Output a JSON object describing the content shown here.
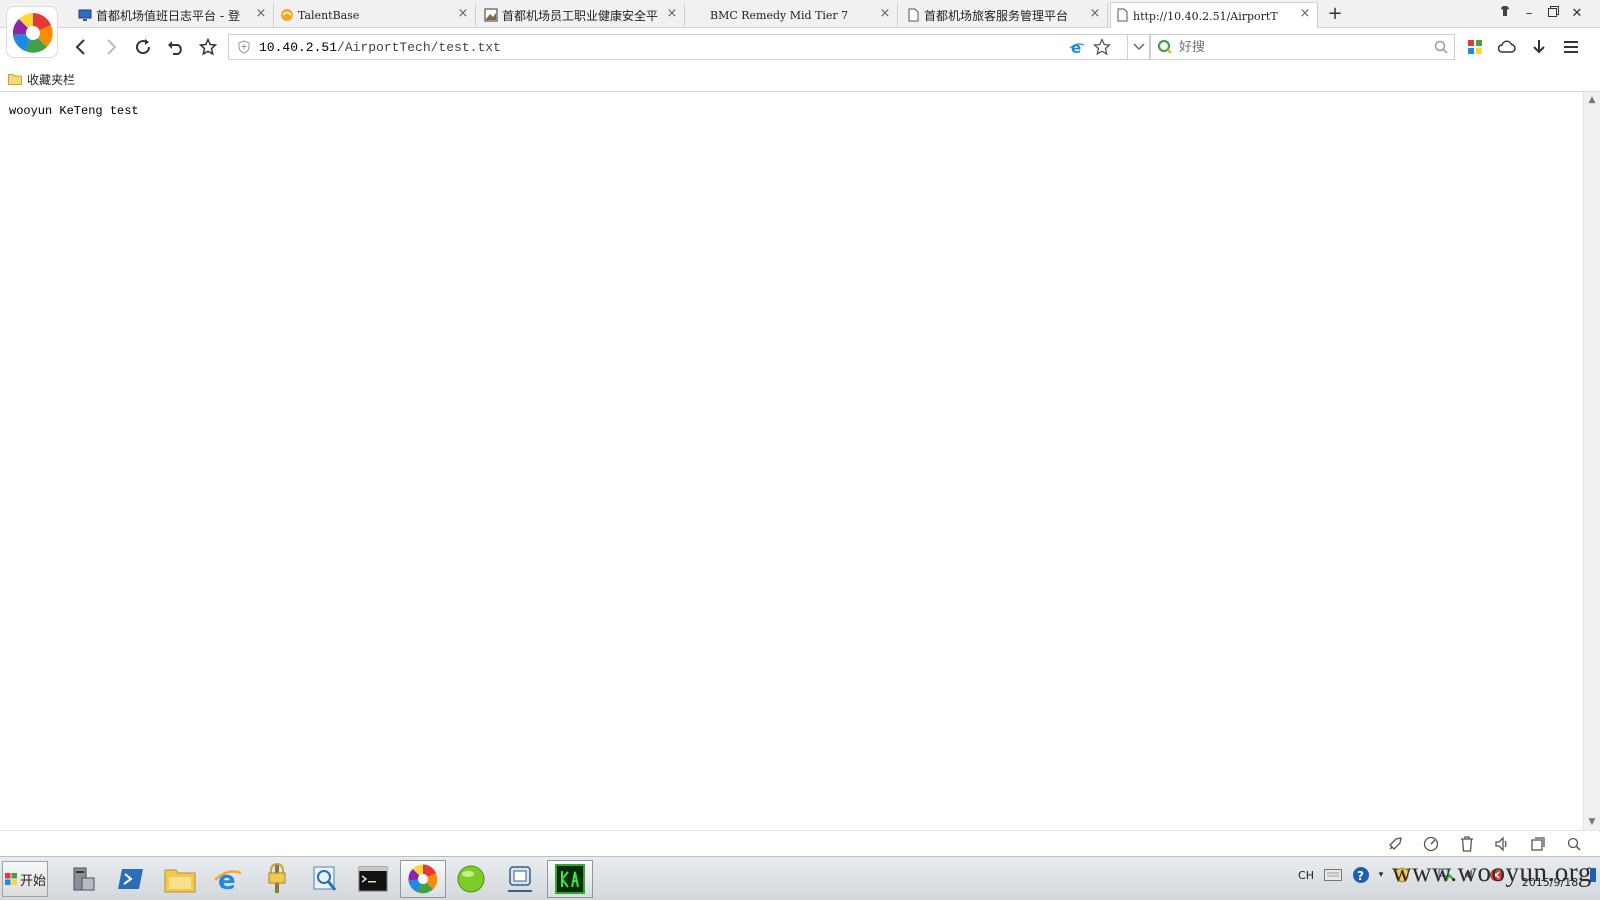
{
  "browser": {
    "tabs": [
      {
        "label": "首都机场值班日志平台 - 登",
        "icon": "monitor-icon"
      },
      {
        "label": "TalentBase",
        "icon": "talentbase-icon"
      },
      {
        "label": "首都机场员工职业健康安全平",
        "icon": "image-page-icon"
      },
      {
        "label": "BMC  Remedy  Mid  Tier  7",
        "icon": "none"
      },
      {
        "label": "首都机场旅客服务管理平台",
        "icon": "page-icon"
      },
      {
        "label": "http://10.40.2.51/AirportT",
        "icon": "page-icon"
      }
    ],
    "new_tab": "+",
    "address": {
      "host": "10.40.2.51",
      "path": "/AirportTech/test.txt"
    },
    "search": {
      "placeholder": "好搜"
    },
    "bookmarks": {
      "folder_label": "收藏夹栏"
    }
  },
  "page": {
    "text": "wooyun KeTeng test"
  },
  "taskbar": {
    "start_label": "开始",
    "tray": {
      "lang": "CH",
      "date": "2015/9/18"
    }
  },
  "watermark": "www.wooyun.org",
  "colors": {
    "accent_blue": "#1e88e5",
    "taskbar_bg": "#dde1e4"
  }
}
